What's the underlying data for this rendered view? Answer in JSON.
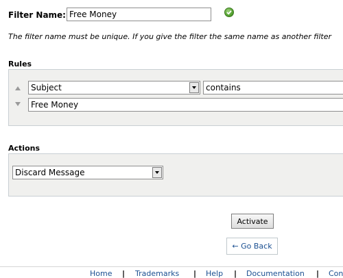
{
  "filter": {
    "label": "Filter Name:",
    "value": "Free Money",
    "note": "The filter name must be unique. If you give the filter the same name as another filter"
  },
  "rules": {
    "heading": "Rules",
    "field_select": "Subject",
    "operator_select": "contains",
    "value": "Free Money"
  },
  "actions": {
    "heading": "Actions",
    "action_select": "Discard Message"
  },
  "buttons": {
    "activate": "Activate",
    "back": "← Go Back"
  },
  "footer": {
    "links": [
      "Home",
      "Trademarks",
      "Help",
      "Documentation",
      "Con"
    ]
  },
  "colors": {
    "link": "#1a4f91",
    "panel_bg": "#f0f0ee",
    "valid_icon": "#55a231"
  }
}
